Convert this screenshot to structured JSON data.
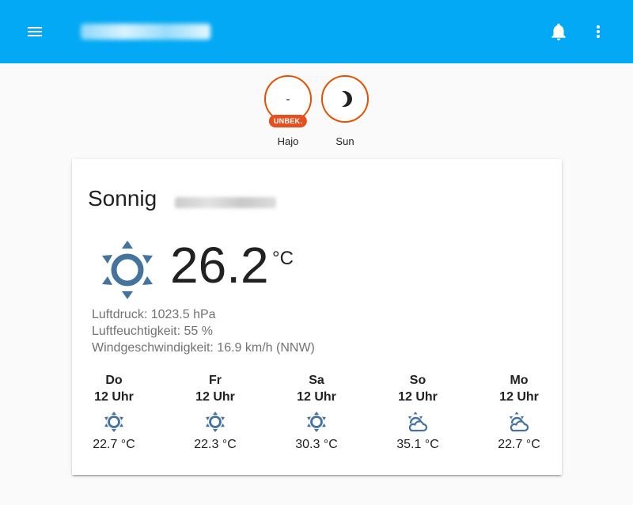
{
  "toolbar": {
    "menu_icon": "menu-icon",
    "notification_icon": "bell-icon",
    "more_icon": "more-vert-icon",
    "background_color": "#03a9f4"
  },
  "badges": [
    {
      "value": "-",
      "chip": "UNBEK.",
      "name": "Hajo"
    },
    {
      "icon": "moon-icon",
      "name": "Sun"
    }
  ],
  "weather": {
    "condition": "Sonnig",
    "icon": "sunny-icon",
    "temperature": "26.2",
    "unit": "°C",
    "attributes": [
      "Luftdruck: 1023.5 hPa",
      "Luftfeuchtigkeit: 55 %",
      "Windgeschwindigkeit: 16.9 km/h (NNW)"
    ],
    "forecast": [
      {
        "day": "Do",
        "time": "12 Uhr",
        "icon": "sunny-icon",
        "temp": "22.7 °C"
      },
      {
        "day": "Fr",
        "time": "12 Uhr",
        "icon": "sunny-icon",
        "temp": "22.3 °C"
      },
      {
        "day": "Sa",
        "time": "12 Uhr",
        "icon": "sunny-icon",
        "temp": "30.3 °C"
      },
      {
        "day": "So",
        "time": "12 Uhr",
        "icon": "partly-cloudy-icon",
        "temp": "35.1 °C"
      },
      {
        "day": "Mo",
        "time": "12 Uhr",
        "icon": "partly-cloudy-icon",
        "temp": "22.7 °C"
      }
    ],
    "icon_color": "#44739e"
  },
  "colors": {
    "badge_border": "#e65100",
    "chip": "#e4511e"
  }
}
